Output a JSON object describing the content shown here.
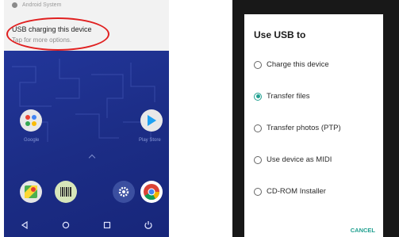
{
  "notification": {
    "app_label": "Android System",
    "title": "USB charging this device",
    "subtitle": "Tap for more options."
  },
  "home": {
    "apps": [
      {
        "name": "Google",
        "icon": "google-folder-icon"
      },
      {
        "name": "Play Store",
        "icon": "play-store-icon"
      }
    ],
    "dock": [
      "maps-icon",
      "barcode-icon",
      "settings-icon",
      "chrome-icon"
    ],
    "nav": [
      "back-icon",
      "home-icon",
      "recents-icon",
      "power-icon"
    ]
  },
  "dialog": {
    "title": "Use USB to",
    "options": [
      {
        "label": "Charge this device",
        "selected": false
      },
      {
        "label": "Transfer files",
        "selected": true
      },
      {
        "label": "Transfer photos (PTP)",
        "selected": false
      },
      {
        "label": "Use device as MIDI",
        "selected": false
      },
      {
        "label": "CD-ROM Installer",
        "selected": false
      }
    ],
    "cancel_label": "CANCEL"
  },
  "colors": {
    "accent": "#20a090",
    "home_bg": "#1c2f8c",
    "highlight": "#e02020"
  }
}
